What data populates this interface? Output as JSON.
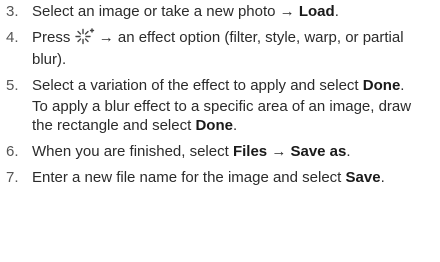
{
  "steps": [
    {
      "num": "3.",
      "p1": "Select an image or take a new photo",
      "arrow": "→",
      "b1": "Load",
      "p2": "."
    },
    {
      "num": "4.",
      "p1": "Press",
      "icon": "sparkle-effect-icon",
      "arrow": "→",
      "p2": "an effect option (filter, style, warp, or partial blur)."
    },
    {
      "num": "5.",
      "p1": "Select a variation of the effect to apply and select",
      "b1": "Done",
      "p2": ".",
      "note_p1": "To apply a blur effect to a specific area of an image, draw the rectangle and select",
      "note_b1": "Done",
      "note_p2": "."
    },
    {
      "num": "6.",
      "p1": "When you are finished, select",
      "b1": "Files",
      "arrow": "→",
      "b2": "Save as",
      "p2": "."
    },
    {
      "num": "7.",
      "p1": "Enter a new file name for the image and select",
      "b1": "Save",
      "p2": "."
    }
  ]
}
